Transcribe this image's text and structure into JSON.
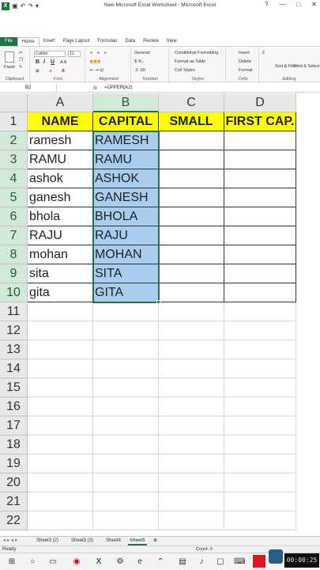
{
  "window": {
    "title": "New Microsoft Excel Worksheet - Microsoft Excel",
    "controls": [
      "?",
      "□",
      "—",
      "✕"
    ]
  },
  "ribbon": {
    "tabs": [
      "File",
      "Home",
      "Insert",
      "Page Layout",
      "Formulas",
      "Data",
      "Review",
      "View"
    ],
    "active_tab": "Home",
    "font_name": "Calibri",
    "font_size": "11",
    "number_format": "General",
    "groups": [
      "Clipboard",
      "Font",
      "Alignment",
      "Number",
      "Styles",
      "Cells",
      "Editing"
    ],
    "paste_label": "Paste",
    "styles_items": [
      "Conditional Formatting",
      "Format as Table",
      "Cell Styles"
    ],
    "cells_items": [
      "Insert",
      "Delete",
      "Format"
    ],
    "editing_items": [
      "Sort & Filter",
      "Find & Select"
    ]
  },
  "formula_bar": {
    "name_box": "B2",
    "fx": "fx",
    "formula": "=UPPER(A2)"
  },
  "sheet": {
    "columns": [
      "A",
      "B",
      "C",
      "D"
    ],
    "rows": [
      "1",
      "2",
      "3",
      "4",
      "5",
      "6",
      "7",
      "8",
      "9",
      "10",
      "11",
      "12",
      "13",
      "14",
      "15",
      "16",
      "17",
      "18",
      "19",
      "20",
      "21",
      "22"
    ],
    "header_row": [
      "NAME",
      "CAPITAL",
      "SMALL",
      "FIRST CAP."
    ],
    "names": [
      "ramesh",
      "RAMU",
      "ashok",
      "ganesh",
      "bhola",
      "RAJU",
      "mohan",
      "sita",
      "gita"
    ],
    "capitals": [
      "RAMESH",
      "RAMU",
      "ASHOK",
      "GANESH",
      "BHOLA",
      "RAJU",
      "MOHAN",
      "SITA",
      "GITA"
    ],
    "active_cell": "B2",
    "selected_range": "B2:B10",
    "colors": {
      "header_fill": "#ffff00",
      "selection_fill": "#a8cdee",
      "accent": "#217346"
    }
  },
  "sheet_tabs": [
    "Sheet3 (2)",
    "Sheet3 (3)",
    "Sheet4",
    "Sheet5"
  ],
  "active_sheet": "Sheet5",
  "status": {
    "ready": "Ready",
    "count": "Count: 9"
  },
  "taskbar": {
    "clock": "00:00:25"
  }
}
